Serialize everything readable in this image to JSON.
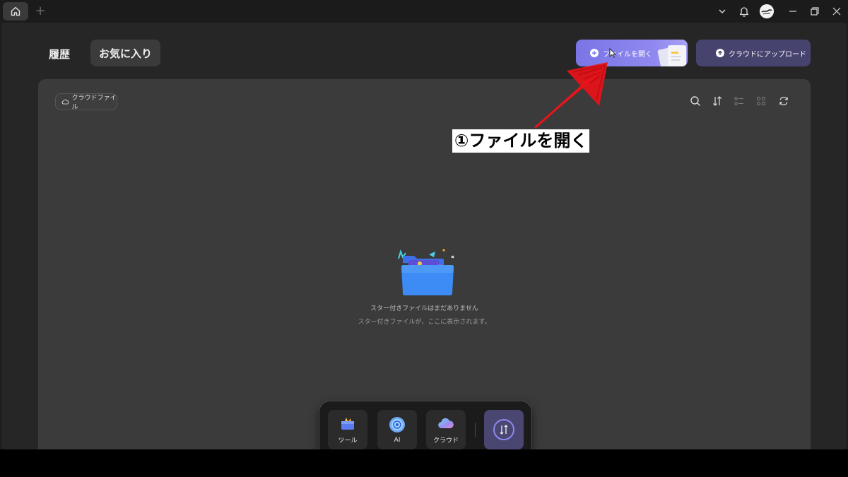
{
  "titlebar": {
    "home_icon": "home-icon",
    "new_tab_label": "+",
    "icons": [
      "chevron-down-icon",
      "bell-icon",
      "avatar",
      "minimize-icon",
      "restore-icon",
      "close-icon"
    ]
  },
  "tabs": {
    "history": "履歴",
    "favorites": "お気に入り"
  },
  "actions": {
    "open_file": "ファイルを開く",
    "upload_cloud": "クラウドにアップロード"
  },
  "panel": {
    "cloud_chip": "クラウドファイル",
    "toolbar_icons": [
      "search-icon",
      "sort-icon",
      "list-view-icon",
      "grid-view-icon",
      "refresh-icon"
    ],
    "empty_title": "スター付きファイルはまだありません",
    "empty_sub": "スター付きファイルが、ここに表示されます。"
  },
  "annotation": {
    "label": "①ファイルを開く"
  },
  "dock": {
    "tools": "ツール",
    "ai": "AI",
    "cloud": "クラウド"
  },
  "colors": {
    "primary_button": "#7a74e6",
    "upload_button": "#47436f",
    "panel_bg": "#3b3b3b",
    "annotation_red": "#e8141a"
  }
}
